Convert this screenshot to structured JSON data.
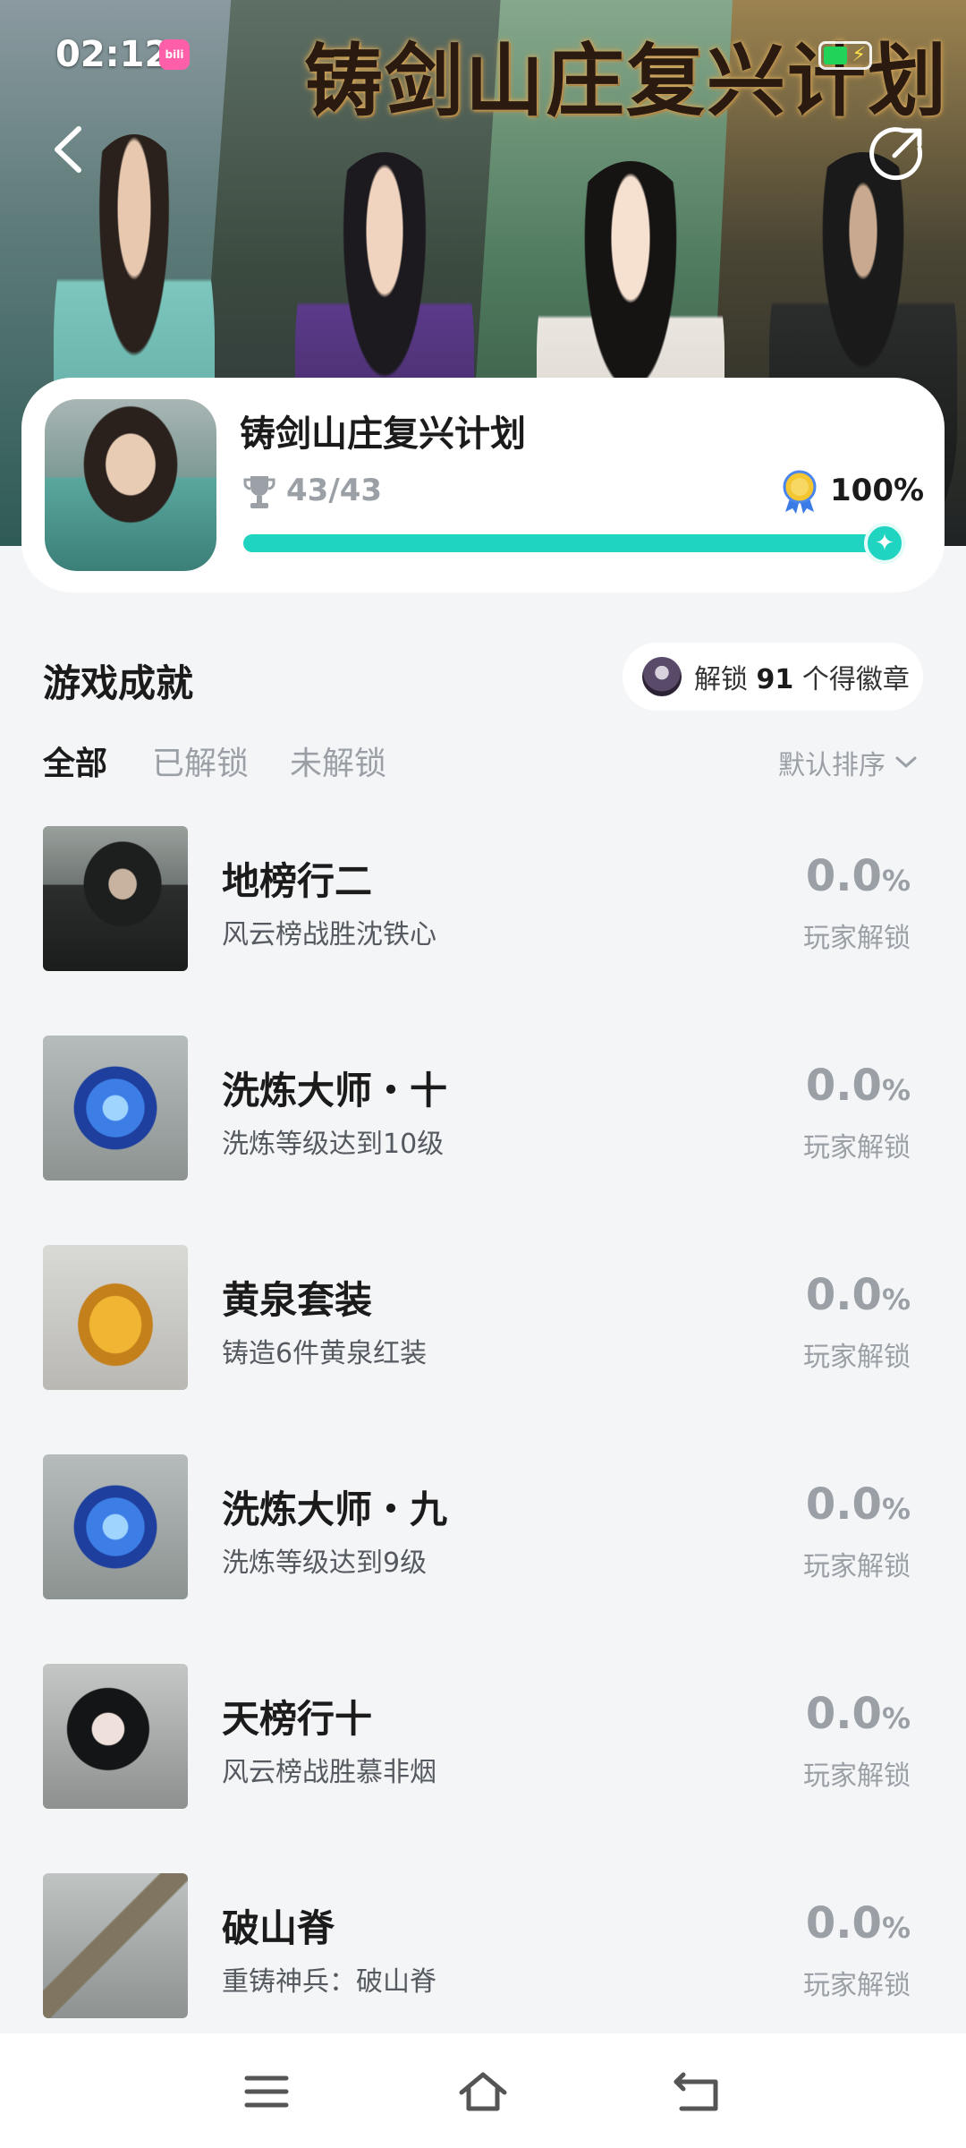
{
  "status_bar": {
    "time": "02:12",
    "app_badge": "bili"
  },
  "hero": {
    "title": "铸剑山庄复兴计划"
  },
  "game_card": {
    "name": "铸剑山庄复兴计划",
    "trophy_count": "43/43",
    "percent": "100%",
    "progress": 1.0
  },
  "section": {
    "title": "游戏成就",
    "badge_prefix": "解锁",
    "badge_count": "91",
    "badge_suffix": "个得徽章"
  },
  "tabs": [
    {
      "label": "全部",
      "active": true
    },
    {
      "label": "已解锁",
      "active": false
    },
    {
      "label": "未解锁",
      "active": false
    }
  ],
  "sort": {
    "label": "默认排序"
  },
  "achievements": [
    {
      "title": "地榜行二",
      "desc": "风云榜战胜沈铁心",
      "rate": "0.0",
      "rate_unit": "%",
      "rate_label": "玩家解锁",
      "icon": "masked-ninja"
    },
    {
      "title": "洗炼大师・十",
      "desc": "洗炼等级达到10级",
      "rate": "0.0",
      "rate_unit": "%",
      "rate_label": "玩家解锁",
      "icon": "blue-rune-gem"
    },
    {
      "title": "黄泉套装",
      "desc": "铸造6件黄泉红装",
      "rate": "0.0",
      "rate_unit": "%",
      "rate_label": "玩家解锁",
      "icon": "golden-robe"
    },
    {
      "title": "洗炼大师・九",
      "desc": "洗炼等级达到9级",
      "rate": "0.0",
      "rate_unit": "%",
      "rate_label": "玩家解锁",
      "icon": "blue-rune-gem"
    },
    {
      "title": "天榜行十",
      "desc": "风云榜战胜慕非烟",
      "rate": "0.0",
      "rate_unit": "%",
      "rate_label": "玩家解锁",
      "icon": "woman-portrait"
    },
    {
      "title": "破山脊",
      "desc": "重铸神兵：破山脊",
      "rate": "0.0",
      "rate_unit": "%",
      "rate_label": "玩家解锁",
      "icon": "broken-sword"
    }
  ],
  "colors": {
    "accent": "#1fd4c0",
    "muted": "#9aa0a6",
    "text": "#1b1b1b",
    "background": "#f4f5f7"
  }
}
